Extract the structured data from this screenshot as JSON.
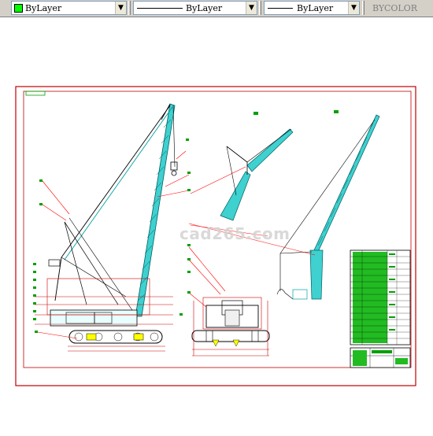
{
  "toolbar": {
    "color_control": {
      "value": "ByLayer",
      "swatch_color": "#00ff00"
    },
    "linetype_control": {
      "value": "ByLayer"
    },
    "lineweight_control": {
      "value": "ByLayer"
    },
    "plotstyle_control": {
      "value": "BYCOLOR"
    }
  },
  "drawing": {
    "watermark": "cad265.com"
  },
  "colors": {
    "frame": "#c00000",
    "structure": "#00c0c0",
    "lines": "#000000",
    "leaders": "#ff0000",
    "table_fill": "#00aa00",
    "background": "#ffffff"
  }
}
